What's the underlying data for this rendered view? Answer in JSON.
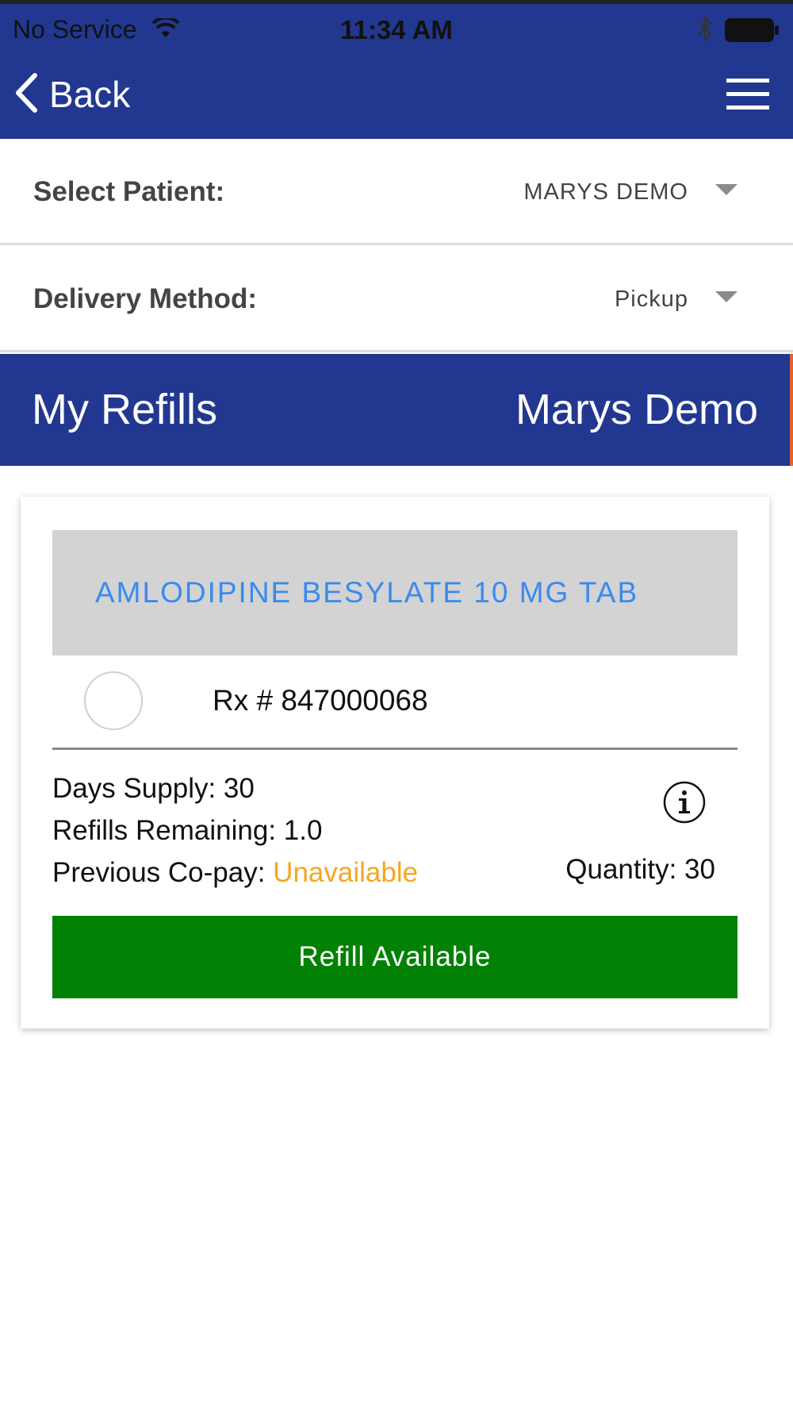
{
  "status_bar": {
    "carrier": "No Service",
    "time": "11:34 AM",
    "wifi_icon": "wifi-icon",
    "bluetooth_icon": "bluetooth-icon",
    "battery_icon": "battery-icon"
  },
  "nav": {
    "back_label": "Back",
    "back_icon": "chevron-left-icon",
    "menu_icon": "hamburger-menu-icon"
  },
  "patient_select": {
    "label": "Select Patient:",
    "value": "MARYS DEMO"
  },
  "delivery_select": {
    "label": "Delivery Method:",
    "value": "Pickup"
  },
  "section": {
    "title": "My Refills",
    "patient_name": "Marys Demo"
  },
  "prescription": {
    "drug_name": "AMLODIPINE BESYLATE 10 MG TAB",
    "rx_number": "Rx # 847000068",
    "days_supply": "Days Supply: 30",
    "refills_remaining": "Refills Remaining: 1.0",
    "copay_label": "Previous Co-pay: ",
    "copay_value": "Unavailable",
    "quantity": "Quantity: 30",
    "button_label": "Refill Available",
    "info_icon": "info-icon"
  },
  "colors": {
    "primary": "#223890",
    "drug_name": "#3a8af0",
    "copay_value": "#f5a623",
    "refill_button": "#028104"
  }
}
